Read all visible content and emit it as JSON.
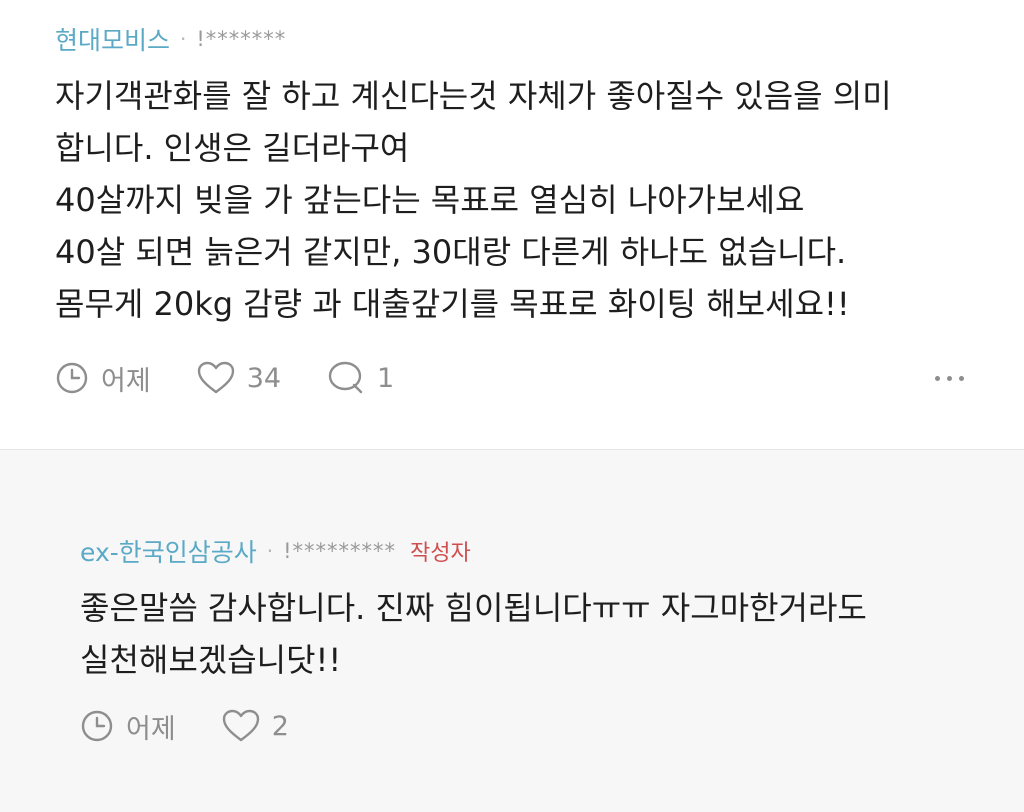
{
  "comments": [
    {
      "author": "현대모비스",
      "separator": "·",
      "masked_id": "!*******",
      "lines": [
        "자기객관화를 잘 하고 계신다는것 자체가 좋아질수 있음을 의미",
        "합니다. 인생은 길더라구여",
        "40살까지 빚을 가 갚는다는 목표로 열심히 나아가보세요",
        "40살 되면 늙은거 같지만, 30대랑 다른게 하나도 없습니다.",
        "몸무게 20kg 감량 과 대출갚기를 목표로 화이팅 해보세요!!"
      ],
      "time": "어제",
      "likes": "34",
      "replies": "1"
    },
    {
      "author": "ex-한국인삼공사",
      "separator": "·",
      "masked_id": "!*********",
      "badge": "작성자",
      "lines": [
        "좋은말씀 감사합니다. 진짜 힘이됩니다ㅠㅠ 자그마한거라도",
        "실천해보겠습니닷!!"
      ],
      "time": "어제",
      "likes": "2"
    }
  ],
  "icons": {
    "clock": "clock-icon",
    "heart": "heart-icon",
    "reply": "speech-bubble-icon",
    "more": "more-dots-icon"
  },
  "colors": {
    "author": "#5aa9c6",
    "badge": "#cf4f4f",
    "meta_gray": "#8e8e8e",
    "reply_bg": "#f7f7f7"
  }
}
